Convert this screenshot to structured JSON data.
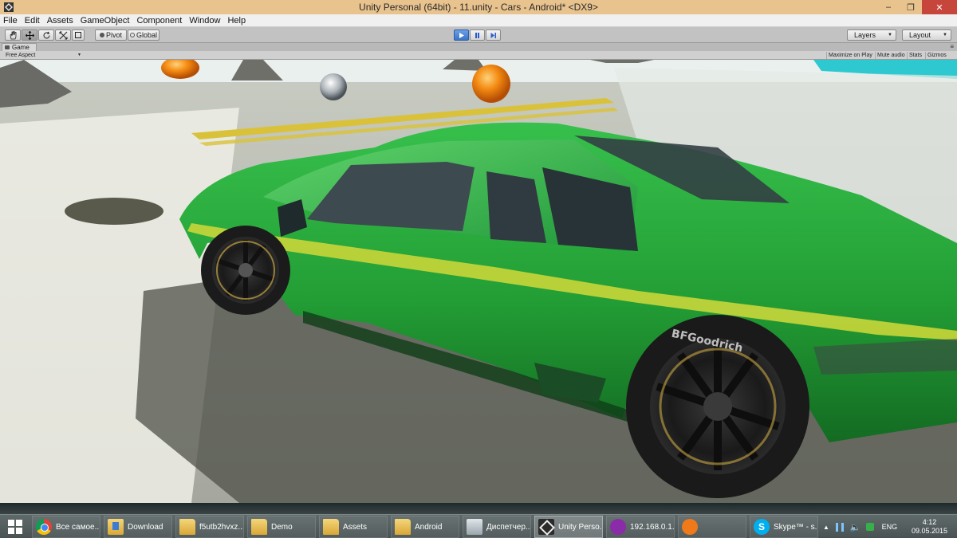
{
  "window": {
    "title": "Unity Personal (64bit) - 11.unity - Cars - Android* <DX9>"
  },
  "menu": [
    "File",
    "Edit",
    "Assets",
    "GameObject",
    "Component",
    "Window",
    "Help"
  ],
  "toolbar": {
    "pivot_label": "Pivot",
    "global_label": "Global",
    "layers_label": "Layers",
    "layout_label": "Layout"
  },
  "game": {
    "tab_label": "Game",
    "aspect_value": "Free Aspect",
    "maximize_label": "Maximize on Play",
    "mute_label": "Mute audio",
    "stats_label": "Stats",
    "gizmos_label": "Gizmos"
  },
  "scene": {
    "tire_text": "BFGoodrich",
    "colors": {
      "car": "#22a33a",
      "stripe": "#c9d63a",
      "road": "#8c8d85",
      "sky": "#eef4f3"
    }
  },
  "taskbar": {
    "items": [
      {
        "label": "Все самое...",
        "icon": "chrome-icon"
      },
      {
        "label": "Download",
        "icon": "folder-download-icon"
      },
      {
        "label": "f5utb2hvxz...",
        "icon": "folder-icon"
      },
      {
        "label": "Demo",
        "icon": "folder-icon"
      },
      {
        "label": "Assets",
        "icon": "folder-icon"
      },
      {
        "label": "Android",
        "icon": "folder-icon"
      },
      {
        "label": "Диспетчер...",
        "icon": "task-manager-icon"
      },
      {
        "label": "Unity Perso...",
        "icon": "unity-icon"
      },
      {
        "label": "192.168.0.1...",
        "icon": "remote-desktop-icon"
      },
      {
        "label": "",
        "icon": "avast-icon"
      },
      {
        "label": "Skype™ - s...",
        "icon": "skype-icon"
      }
    ],
    "lang": "ENG",
    "time": "4:12",
    "date": "09.05.2015"
  }
}
